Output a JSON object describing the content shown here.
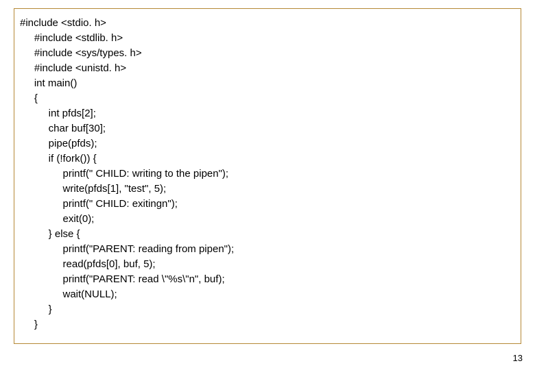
{
  "page_number": "13",
  "code": {
    "lines": [
      {
        "indent": 0,
        "text": "#include <stdio. h>"
      },
      {
        "indent": 1,
        "text": "#include <stdlib. h>"
      },
      {
        "indent": 1,
        "text": "#include <sys/types. h>"
      },
      {
        "indent": 1,
        "text": "#include <unistd. h>"
      },
      {
        "indent": 1,
        "text": "int main()"
      },
      {
        "indent": 1,
        "text": "{"
      },
      {
        "indent": 2,
        "text": "int pfds[2];"
      },
      {
        "indent": 2,
        "text": "char buf[30];"
      },
      {
        "indent": 2,
        "text": "pipe(pfds);"
      },
      {
        "indent": 2,
        "text": "if (!fork()) {"
      },
      {
        "indent": 3,
        "text": "printf(\" CHILD: writing to the pipen\");"
      },
      {
        "indent": 3,
        "text": "write(pfds[1], \"test\", 5);"
      },
      {
        "indent": 3,
        "text": "printf(\" CHILD: exitingn\");"
      },
      {
        "indent": 3,
        "text": "exit(0);"
      },
      {
        "indent": 2,
        "text": "} else {"
      },
      {
        "indent": 3,
        "text": "printf(\"PARENT: reading from pipen\");"
      },
      {
        "indent": 3,
        "text": "read(pfds[0], buf, 5);"
      },
      {
        "indent": 3,
        "text": "printf(\"PARENT: read \\\"%s\\\"n\", buf);"
      },
      {
        "indent": 3,
        "text": "wait(NULL);"
      },
      {
        "indent": 2,
        "text": "}"
      },
      {
        "indent": 1,
        "text": "}"
      }
    ]
  }
}
